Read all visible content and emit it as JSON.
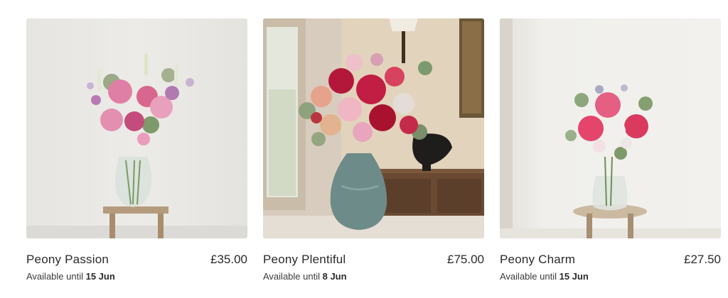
{
  "products": [
    {
      "name": "Peony Passion",
      "price": "£35.00",
      "availability_prefix": "Available until",
      "availability_date": "15 Jun",
      "image_subject": "pink peonies in glass vase on wooden stool"
    },
    {
      "name": "Peony Plentiful",
      "price": "£75.00",
      "availability_prefix": "Available until",
      "availability_date": "8 Jun",
      "image_subject": "red and pink peony bouquet in green ceramic vase"
    },
    {
      "name": "Peony Charm",
      "price": "£27.50",
      "availability_prefix": "Available until",
      "availability_date": "15 Jun",
      "image_subject": "pink peonies in small glass vase on round stool"
    }
  ],
  "colors": {
    "text": "#2a2a2a",
    "muted": "#3a3a3a",
    "background": "#ffffff"
  }
}
